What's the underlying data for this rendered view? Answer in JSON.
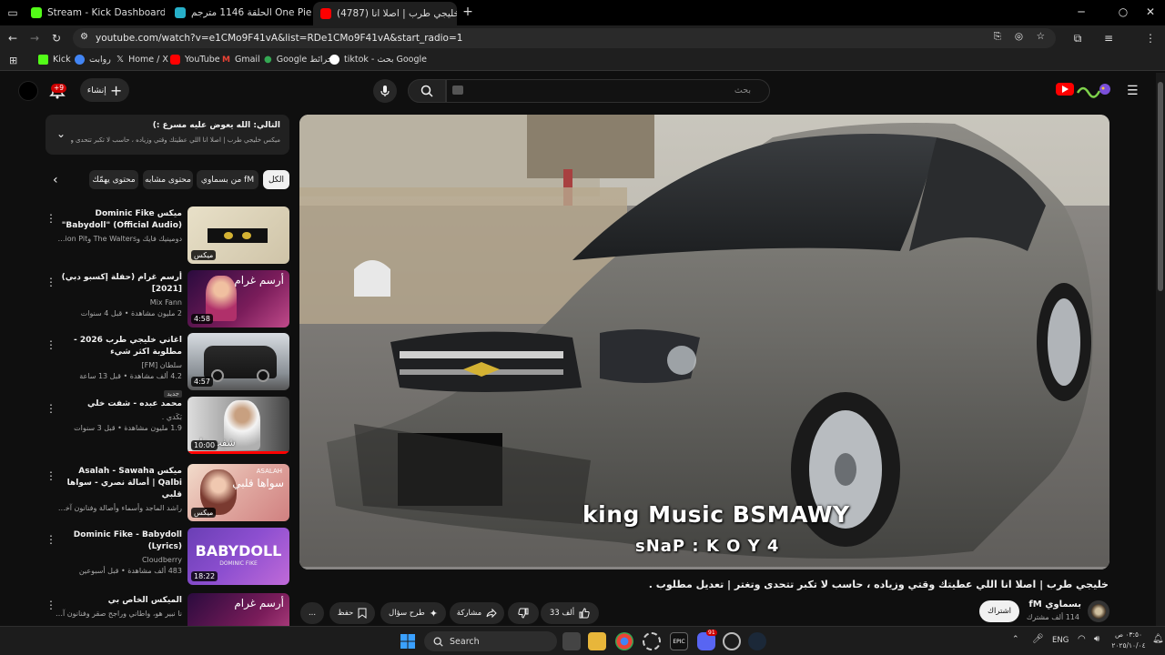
{
  "tabs": [
    {
      "title": "Stream - Kick Dashboard",
      "close": "✕"
    },
    {
      "title": "انمي One Piece الحلقة 1146 مترجم",
      "close": "✕"
    },
    {
      "title": "(4787) خليجي طرب | اصلا انا",
      "close": "✕"
    }
  ],
  "browser": {
    "url": "youtube.com/watch?v=e1CMo9F41vA&list=RDe1CMo9F41vA&start_radio=1",
    "new_tab": "+"
  },
  "bookmarks": [
    {
      "label": "Kick",
      "color": "#53fc18"
    },
    {
      "label": "روابت",
      "color": "#4285f4"
    },
    {
      "label": "Home / X",
      "color": "#000000"
    },
    {
      "label": "YouTube",
      "color": "#ff0000"
    },
    {
      "label": "Gmail",
      "color": "#ea4335"
    },
    {
      "label": "Google خرائط",
      "color": "#34a853"
    },
    {
      "label": "tiktok - بحث Google",
      "color": "#ffffff"
    }
  ],
  "header": {
    "search_placeholder": "بحث",
    "create_label": "إنشاء",
    "notif_count": "+9"
  },
  "mix_panel": {
    "title": "التالي: الله يعوض عليه مسرع :)",
    "subtitle": "ميكس خليجي طرب | اصلا انا اللي عطيتك وقتي وزياده ، حاسب لا تكبر تتحدى وتغتر ..."
  },
  "chips": [
    "الكل",
    "من بسماوي fM",
    "محتوى مشابه",
    "محتوى يهمّك"
  ],
  "playlist": [
    {
      "title": "ميكس Dominic Fike \"Babydoll\" (Official Audio)",
      "line2": "دومينيك فايك وThe Walters وPassion Pit وفنانون...",
      "line3": "",
      "duration": "ميكس",
      "badge": ""
    },
    {
      "title": "أرسم غرام (حفلة إكسبو دبي) [2021]",
      "line2": "Mix Fann",
      "line3": "2 مليون مشاهدة • قبل 4 سنوات",
      "duration": "4:58",
      "badge": ""
    },
    {
      "title": "اغاني خليجي طرب 2026 - مطلوبة اكثر شيء",
      "line2": "سلطان [FM]",
      "line3": "4.2 ألف مشاهدة • قبل 13 ساعة",
      "duration": "4:57",
      "badge": "جديد"
    },
    {
      "title": "محمد عبده - شفت خلي",
      "line2": "بَكَدي .",
      "line3": "1.9 مليون مشاهدة • قبل 3 سنوات",
      "duration": "10:00",
      "badge": ""
    },
    {
      "title": "ميكس Asalah - Sawaha Qalbi | أصالة نصري - سواها قلبي",
      "line2": "راشد الماجد وأسماء وأصالة وفنانون آخرون",
      "line3": "",
      "duration": "ميكس",
      "badge": ""
    },
    {
      "title": "Dominic Fike - Babydoll (Lyrics)",
      "line2": "Cloudberry",
      "line3": "483 ألف مشاهدة • قبل أسبوعين",
      "duration": "18:22",
      "badge": ""
    },
    {
      "title": "الميكس الخاص بي",
      "line2": "نا نبير هو، واطاني وراجح صقر وفنانون آخرون",
      "line3": "",
      "duration": "",
      "badge": ""
    }
  ],
  "thumb_texts": {
    "t2": "أرسم غرام",
    "t4": "شفت خلي",
    "t5": "سواها قلبي",
    "t5b": "ASALAH",
    "t6": "BABYDOLL",
    "t6b": "DOMINIC FIKE",
    "t7": "أرسم غرام"
  },
  "video": {
    "overlay_line1": "king Music BSMAWY",
    "overlay_line2": "sNaP : K O Y 4",
    "title": "خليجي طرب | اصلا انا اللي عطيتك وقتي وزياده ، حاسب لا تكبر تتحدى وتغتر | تعديل مطلوب .",
    "channel": "بسماوي fM",
    "subscribers": "114 ألف مشترك",
    "subscribe": "اشتراك",
    "likes": "33 ألف",
    "share": "مشاركة",
    "ask": "طرح سؤال",
    "save": "حفظ",
    "more": "..."
  },
  "taskbar": {
    "search": "Search",
    "lang": "ENG",
    "time": "٠٣:٥٠ ص",
    "date": "٢٠٢٥/١٠/٠٤",
    "discord_badge": "91"
  }
}
